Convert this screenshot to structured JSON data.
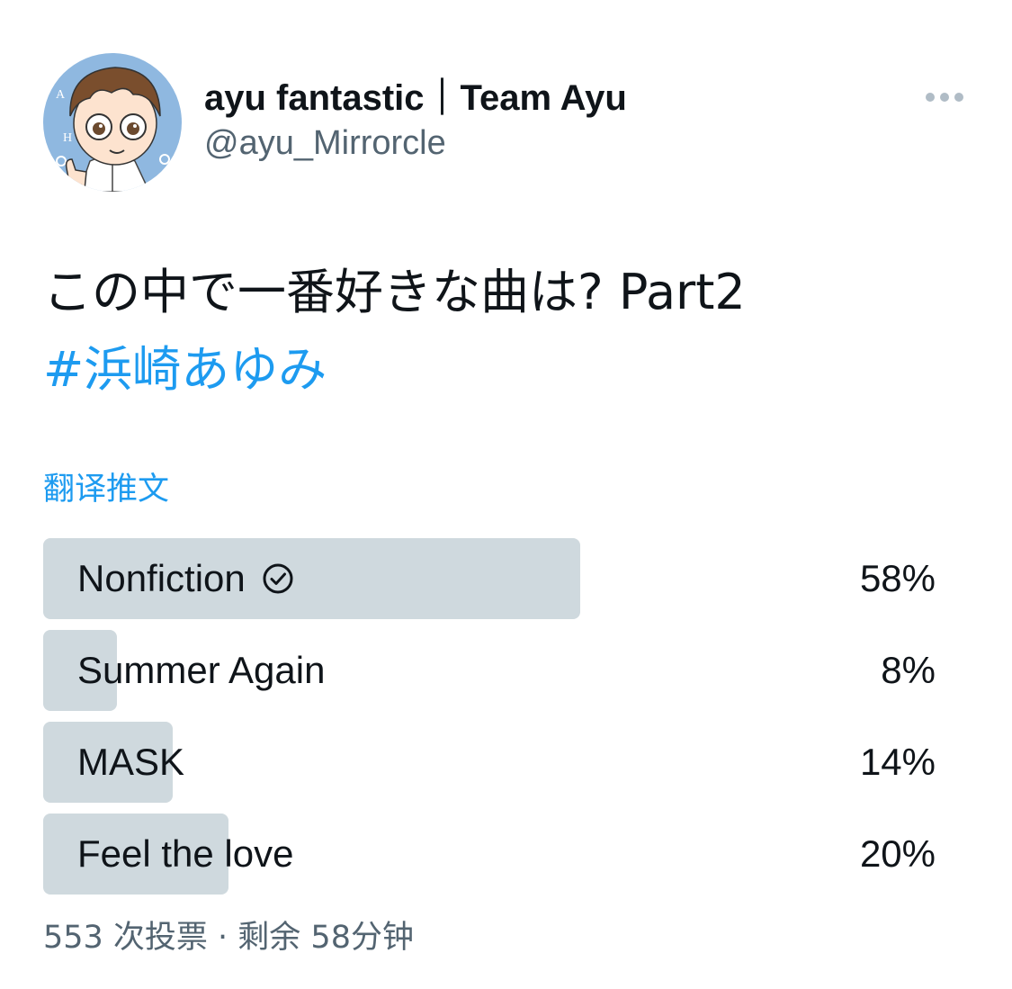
{
  "author": {
    "display_name": "ayu fantastic｜Team Ayu",
    "handle": "@ayu_Mirrorcle",
    "avatar_icon": "cartoon-avatar-icon"
  },
  "menu": {
    "icon": "more-horizontal-icon"
  },
  "tweet": {
    "text_line1": "この中で一番好きな曲は?  Part2",
    "hashtag": "#浜崎あゆみ"
  },
  "translate_label": "翻译推文",
  "poll": {
    "options": [
      {
        "label": "Nonfiction",
        "percent_label": "58%",
        "percent": 58,
        "winner": true
      },
      {
        "label": "Summer Again",
        "percent_label": "8%",
        "percent": 8,
        "winner": false
      },
      {
        "label": "MASK",
        "percent_label": "14%",
        "percent": 14,
        "winner": false
      },
      {
        "label": "Feel the love",
        "percent_label": "20%",
        "percent": 20,
        "winner": false
      }
    ],
    "meta": "553 次投票 · 剩余 58分钟"
  },
  "colors": {
    "accent": "#1d9bf0",
    "bar": "#cfd9de",
    "secondary_text": "#536471",
    "text": "#0f1419"
  }
}
